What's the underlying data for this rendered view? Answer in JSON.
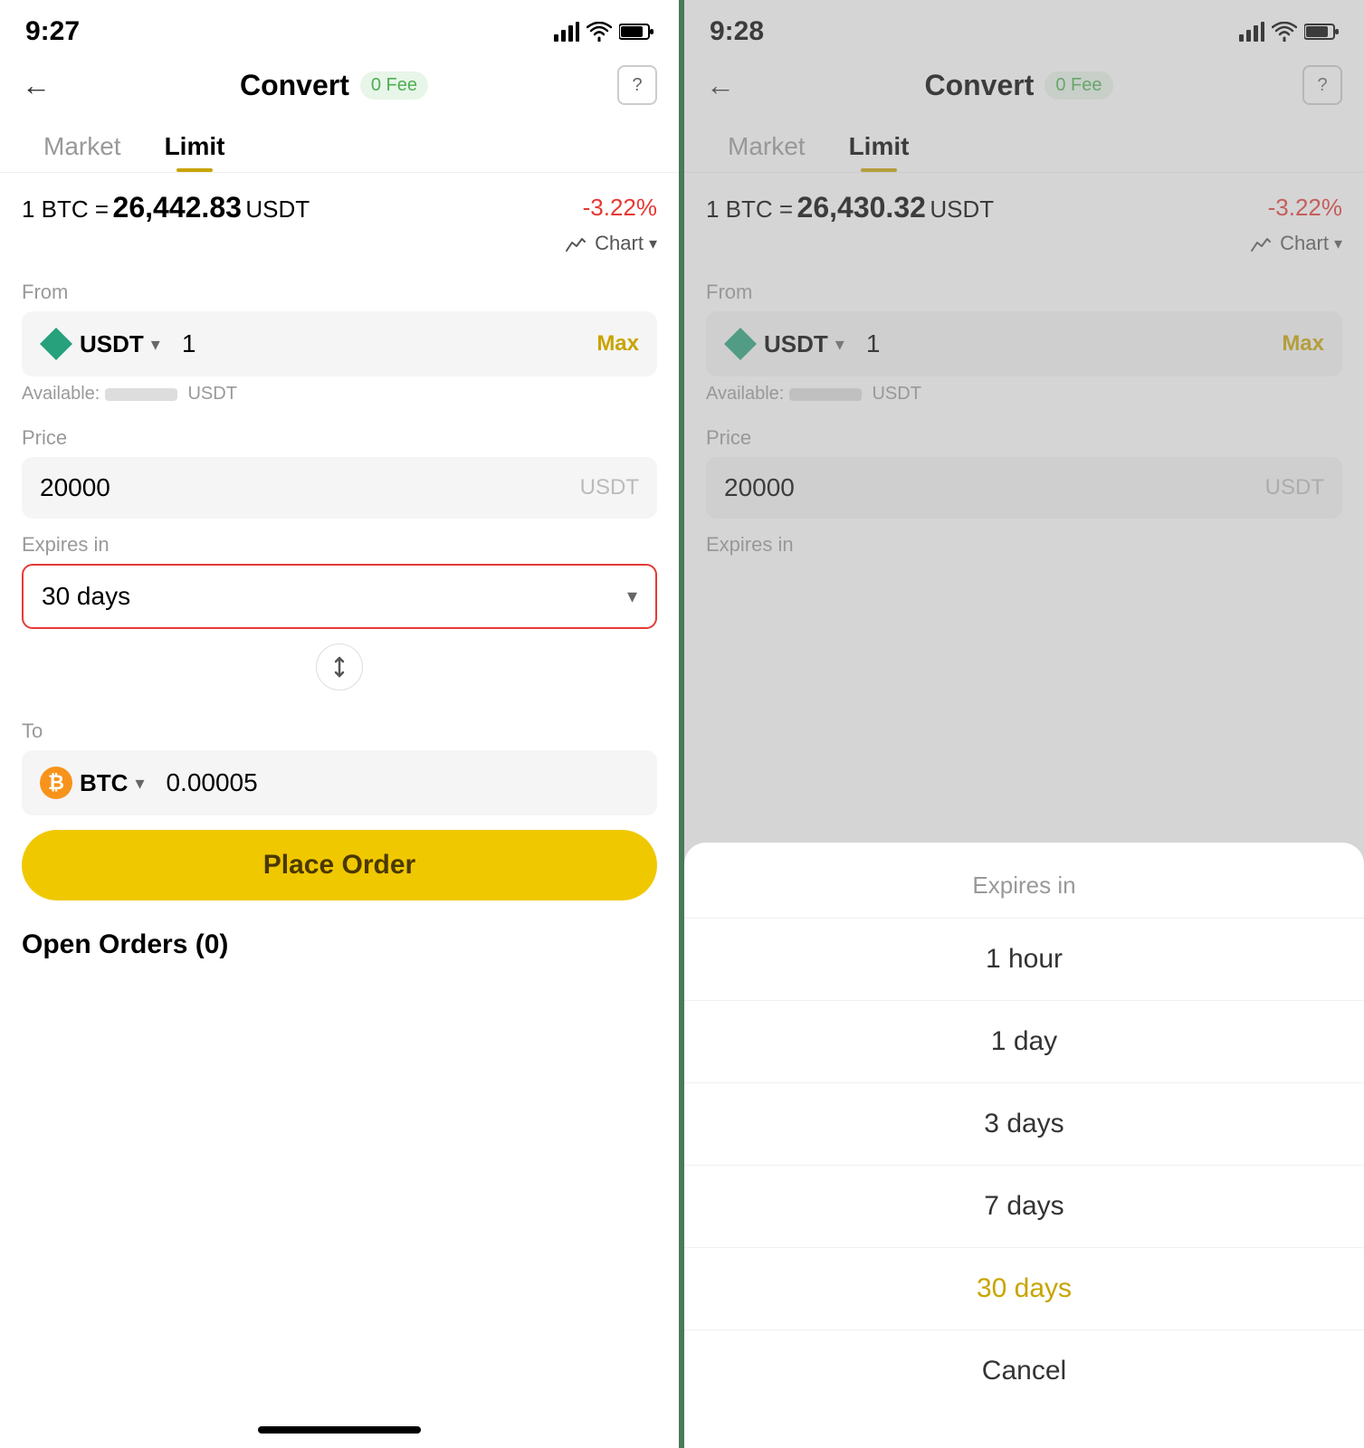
{
  "left_screen": {
    "status": {
      "time": "9:27"
    },
    "header": {
      "back_label": "←",
      "title": "Convert",
      "fee_badge": "0 Fee",
      "help_label": "?"
    },
    "tabs": [
      {
        "label": "Market",
        "active": false
      },
      {
        "label": "Limit",
        "active": true
      }
    ],
    "price_row": {
      "base": "1 BTC =",
      "value": "26,442.83",
      "quote": "USDT",
      "change": "-3.22%"
    },
    "chart_toggle": {
      "label": "Chart",
      "arrow": "▾"
    },
    "from_section": {
      "label": "From",
      "currency": "USDT",
      "amount": "1",
      "max_label": "Max",
      "available_label": "Available:"
    },
    "price_section": {
      "label": "Price",
      "value": "20000",
      "unit": "USDT"
    },
    "expires_section": {
      "label": "Expires in",
      "value": "30 days",
      "highlighted": true
    },
    "to_section": {
      "label": "To",
      "currency": "BTC",
      "amount": "0.00005"
    },
    "place_order": {
      "label": "Place Order"
    },
    "open_orders": {
      "label": "Open Orders (0)"
    }
  },
  "right_screen": {
    "status": {
      "time": "9:28"
    },
    "header": {
      "back_label": "←",
      "title": "Convert",
      "fee_badge": "0 Fee",
      "help_label": "?"
    },
    "tabs": [
      {
        "label": "Market",
        "active": false
      },
      {
        "label": "Limit",
        "active": true
      }
    ],
    "price_row": {
      "base": "1 BTC =",
      "value": "26,430.32",
      "quote": "USDT",
      "change": "-3.22%"
    },
    "chart_toggle": {
      "label": "Chart",
      "arrow": "▾"
    },
    "from_section": {
      "label": "From",
      "currency": "USDT",
      "amount": "1",
      "max_label": "Max",
      "available_label": "Available:"
    },
    "price_section": {
      "label": "Price",
      "value": "20000",
      "unit": "USDT"
    },
    "expires_section": {
      "label": "Expires in"
    },
    "bottom_sheet": {
      "title": "Expires in",
      "options": [
        {
          "label": "1 hour",
          "value": "1hour",
          "selected": false
        },
        {
          "label": "1 day",
          "value": "1day",
          "selected": false
        },
        {
          "label": "3 days",
          "value": "3days",
          "selected": false
        },
        {
          "label": "7 days",
          "value": "7days",
          "selected": false
        },
        {
          "label": "30 days",
          "value": "30days",
          "selected": true
        },
        {
          "label": "Cancel",
          "value": "cancel",
          "selected": false
        }
      ]
    }
  }
}
